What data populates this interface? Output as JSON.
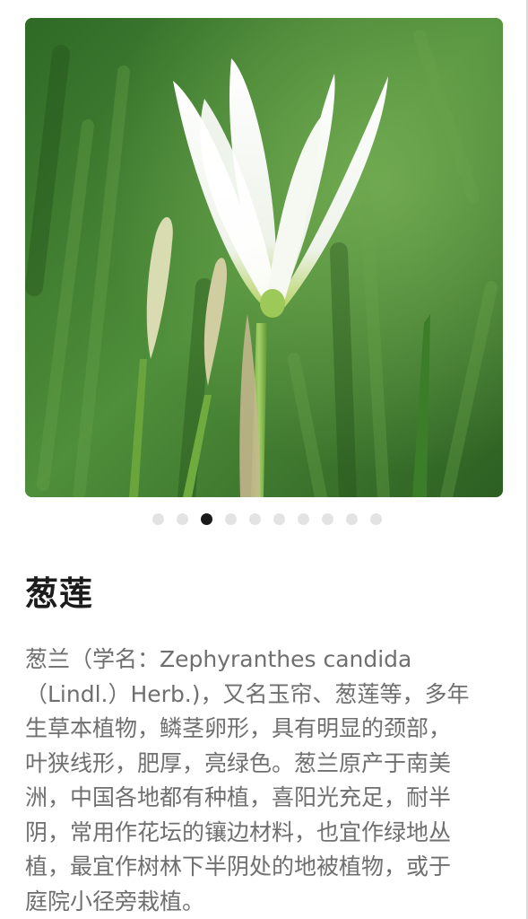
{
  "gallery": {
    "image_description_icon": "flower-photo",
    "pagination": {
      "total": 10,
      "active_index": 2
    }
  },
  "plant": {
    "name": "葱莲",
    "description_lines": [
      "葱兰（学名：Zephyranthes candida",
      "（Lindl.）Herb.)，又名玉帘、葱莲等，多年",
      "生草本植物，鳞茎卵形，具有明显的颈部，",
      "叶狭线形，肥厚，亮绿色。葱兰原产于南美",
      "洲，中国各地都有种植，喜阳光充足，耐半",
      "阴，常用作花坛的镶边材料，也宜作绿地丛",
      "植，最宜作树林下半阴处的地被植物，或于",
      "庭院小径旁栽植。"
    ]
  },
  "colors": {
    "active_dot": "#1a1a1a",
    "inactive_dot": "#e3e3e3",
    "title": "#1c1c1c",
    "body_text": "#6f6f6f"
  }
}
